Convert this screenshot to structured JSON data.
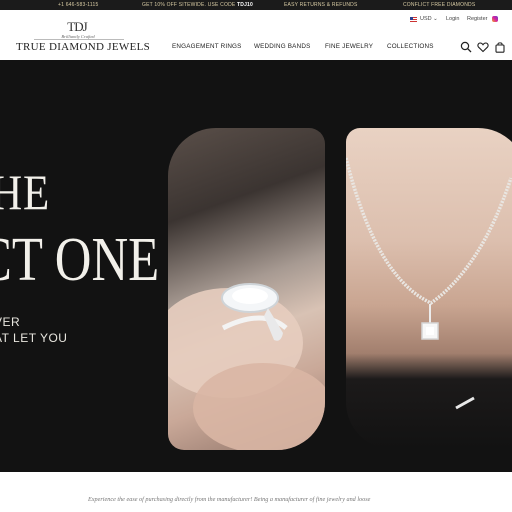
{
  "announcement": {
    "phone": "+1 646-583-1115",
    "promo_prefix": "GET 10% OFF SITEWIDE. USE CODE",
    "promo_code": "TDJ10",
    "returns": "EASY RETURNS & REFUNDS",
    "conflict": "CONFLICT FREE DIAMONDS"
  },
  "header": {
    "logo_monogram": "TDJ",
    "logo_tagline": "Brilliantly Crafted",
    "logo_wordmark": "TRUE DIAMOND JEWELS",
    "currency": "USD",
    "login": "Login",
    "register": "Register",
    "nav": [
      "ENGAGEMENT RINGS",
      "WEDDING BANDS",
      "FINE JEWELRY",
      "COLLECTIONS"
    ],
    "icons": [
      "search-icon",
      "heart-icon",
      "bag-icon"
    ]
  },
  "hero": {
    "line1": "THE",
    "line2": "CT ONE",
    "sub1": "VER",
    "sub2": "AT LET YOU"
  },
  "intro": {
    "text": "Experience the ease of purchasing directly from the manufacturer! Being a manufacturer of fine jewelry and loose"
  },
  "colors": {
    "topbar_bg": "#1b1b1b",
    "topbar_text": "#d8cba4",
    "hero_bg": "#121212",
    "hero_text": "#f2f0ea"
  }
}
